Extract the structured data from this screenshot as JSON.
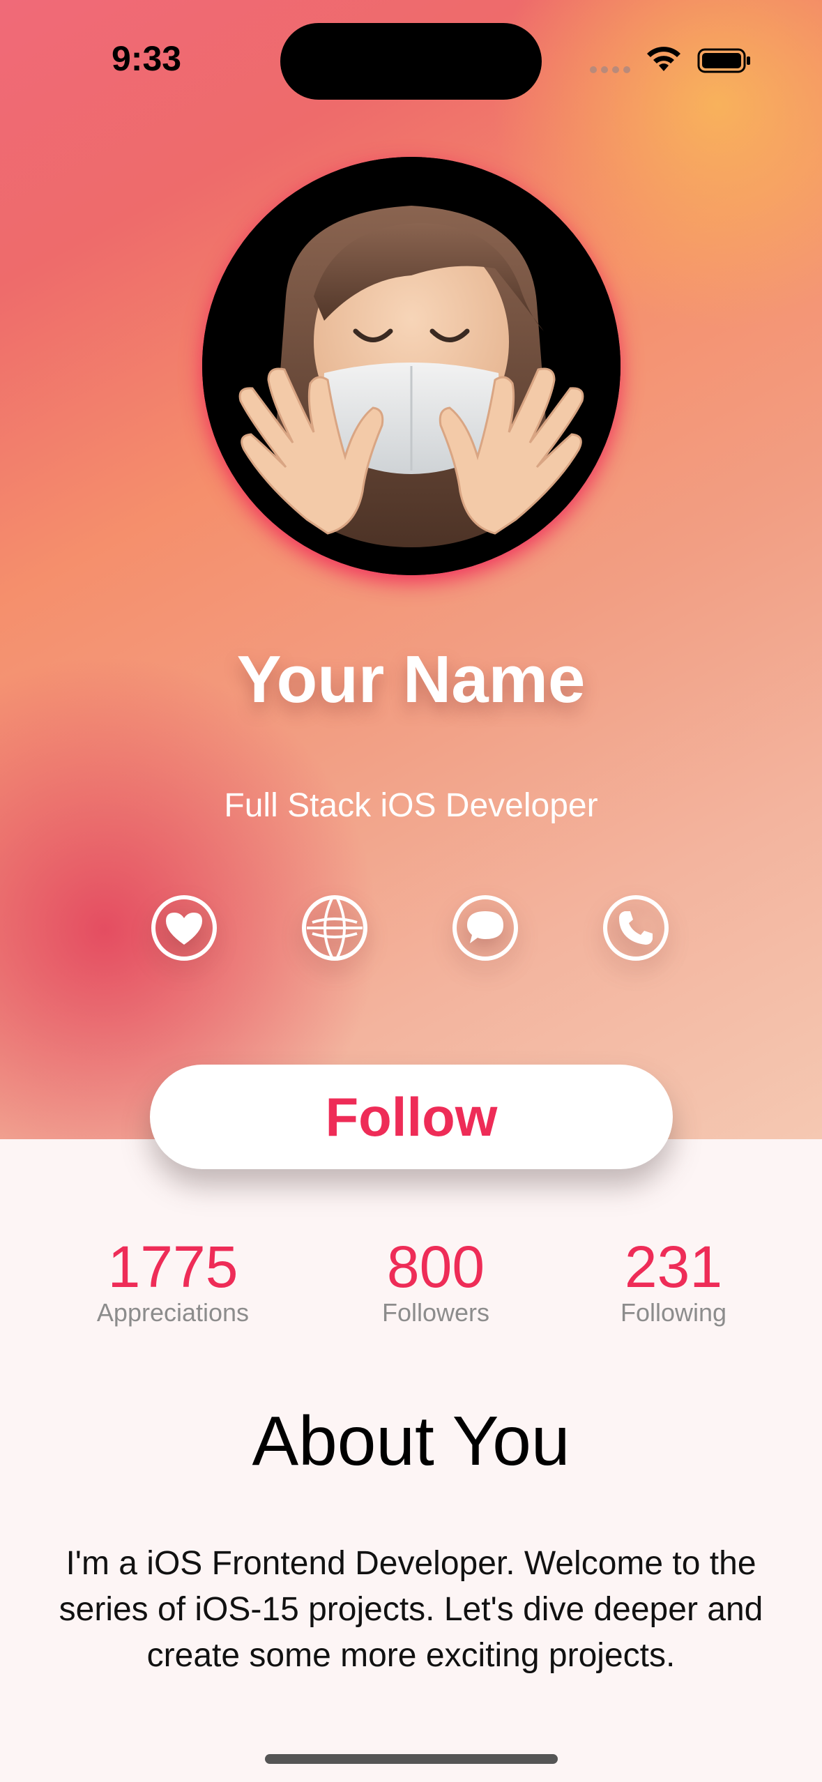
{
  "status_bar": {
    "time": "9:33"
  },
  "profile": {
    "name": "Your Name",
    "role": "Full Stack iOS Developer"
  },
  "actions": [
    {
      "icon": "heart-icon"
    },
    {
      "icon": "globe-icon"
    },
    {
      "icon": "message-icon"
    },
    {
      "icon": "phone-icon"
    }
  ],
  "follow_button": {
    "label": "Follow"
  },
  "stats": [
    {
      "value": "1775",
      "label": "Appreciations"
    },
    {
      "value": "800",
      "label": "Followers"
    },
    {
      "value": "231",
      "label": "Following"
    }
  ],
  "about": {
    "title": "About You",
    "text": "I'm a iOS Frontend Developer. Welcome to the series of iOS-15 projects. Let's dive deeper and create some more exciting projects."
  },
  "colors": {
    "accent": "#ee2c57",
    "gradient_start": "#e23e5a",
    "gradient_end": "#f9ba59"
  }
}
